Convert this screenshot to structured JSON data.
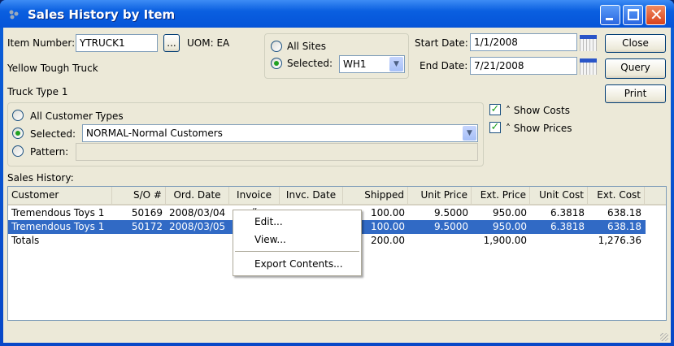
{
  "window": {
    "title": "Sales History by Item"
  },
  "item": {
    "label": "Item Number:",
    "value": "YTRUCK1",
    "lookup": "...",
    "uom": "UOM: EA",
    "desc1": "Yellow Tough Truck",
    "desc2": "Truck Type 1"
  },
  "site": {
    "all": "All Sites",
    "selected": "Selected:",
    "value": "WH1"
  },
  "dates": {
    "start_label": "Start Date:",
    "start": "1/1/2008",
    "end_label": "End Date:",
    "end": "7/21/2008"
  },
  "buttons": {
    "close": "Close",
    "query": "Query",
    "print": "Print"
  },
  "customer": {
    "all": "All Customer Types",
    "selected": "Selected:",
    "selected_value": "NORMAL-Normal Customers",
    "pattern": "Pattern:",
    "pattern_value": ""
  },
  "options": {
    "show_costs": "Show Costs",
    "show_prices": "Show Prices"
  },
  "table": {
    "label": "Sales History:",
    "columns": [
      "Customer",
      "S/O #",
      "Ord. Date",
      "Invoice #",
      "Invc. Date",
      "Shipped",
      "Unit Price",
      "Ext. Price",
      "Unit Cost",
      "Ext. Cost"
    ],
    "rows": [
      [
        "Tremendous Toys 1",
        "50169",
        "2008/03/04",
        "",
        "",
        "100.00",
        "9.5000",
        "950.00",
        "6.3818",
        "638.18"
      ],
      [
        "Tremendous Toys 1",
        "50172",
        "2008/03/05",
        "",
        "",
        "100.00",
        "9.5000",
        "950.00",
        "6.3818",
        "638.18"
      ],
      [
        "Totals",
        "",
        "",
        "",
        "",
        "200.00",
        "",
        "1,900.00",
        "",
        "1,276.36"
      ]
    ]
  },
  "context_menu": {
    "items": [
      "Edit...",
      "View...",
      "Export Contents..."
    ]
  }
}
